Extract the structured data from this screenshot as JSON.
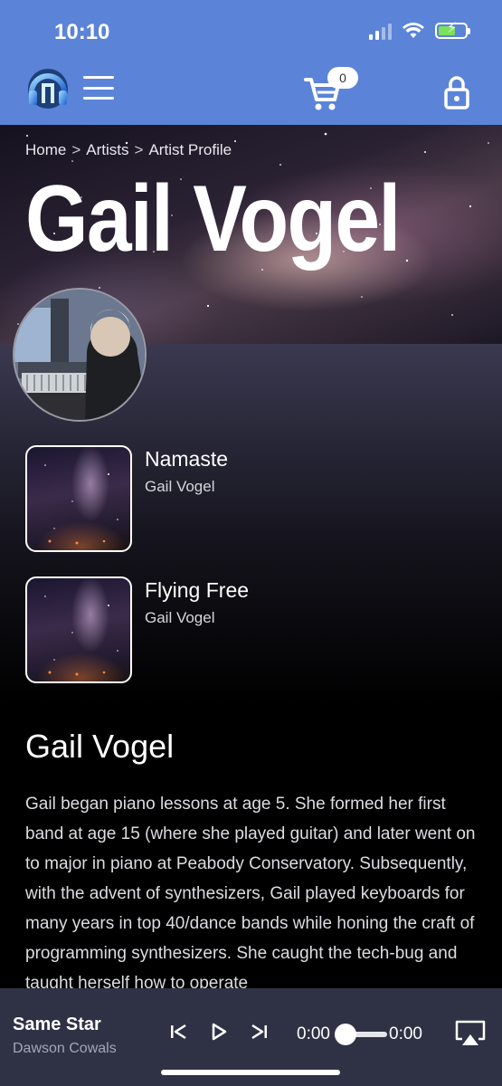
{
  "status_bar": {
    "time": "10:10"
  },
  "header": {
    "cart_count": "0"
  },
  "breadcrumb": {
    "home": "Home",
    "artists": "Artists",
    "current": "Artist Profile",
    "separator": ">"
  },
  "artist": {
    "name": "Gail Vogel"
  },
  "tracks": [
    {
      "title": "Namaste",
      "artist": "Gail Vogel"
    },
    {
      "title": "Flying Free",
      "artist": "Gail Vogel"
    }
  ],
  "bio": {
    "heading": "Gail Vogel",
    "text": "Gail began piano lessons at age 5. She formed her first band at age 15 (where she played guitar) and later went on to major in piano at Peabody Conservatory. Subsequently, with the advent of synthesizers, Gail played keyboards for many years in top 40/dance bands while honing the craft of programming synthesizers. She caught the tech-bug and taught herself how to operate"
  },
  "player": {
    "title": "Same Star",
    "artist": "Dawson Cowals",
    "time_elapsed": "0:00",
    "time_total": "0:00",
    "progress": 0
  },
  "colors": {
    "header": "#5b84d8",
    "player": "#2f3244",
    "battery": "#7be05a"
  },
  "icons": {
    "logo": "headphones-logo-icon",
    "menu": "hamburger-menu-icon",
    "cart": "shopping-cart-icon",
    "lock": "lock-icon",
    "prev": "skip-previous-icon",
    "play": "play-icon",
    "next": "skip-next-icon",
    "airplay": "airplay-icon"
  }
}
